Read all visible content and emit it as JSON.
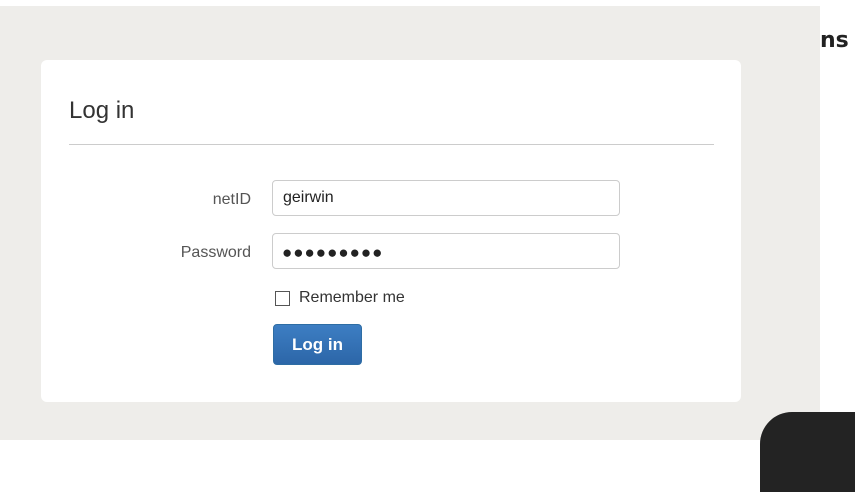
{
  "background": {
    "partial_heading": "ns"
  },
  "login_panel": {
    "title": "Log in",
    "netid": {
      "label": "netID",
      "value": "geirwin"
    },
    "password": {
      "label": "Password",
      "masked_value": "●●●●●●●●●"
    },
    "remember": {
      "label": "Remember me",
      "checked": false
    },
    "submit_label": "Log in"
  },
  "colors": {
    "page_background": "#eeedea",
    "panel_background": "#ffffff",
    "button_primary": "#337ab7",
    "text": "#333333"
  }
}
